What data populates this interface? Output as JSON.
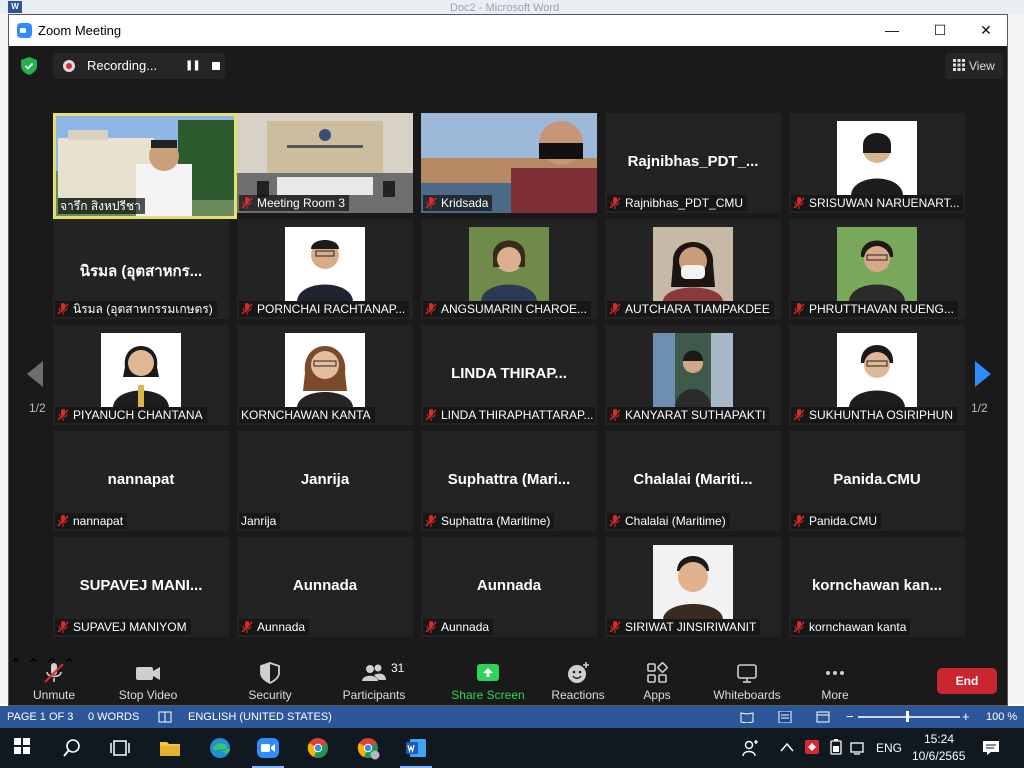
{
  "background_app": {
    "title": "Doc2 - Microsoft Word",
    "logo": "W"
  },
  "window": {
    "title": "Zoom Meeting",
    "minimize": "—",
    "maximize": "☐",
    "close": "✕"
  },
  "recording": {
    "label": "Recording...",
    "pause": "❚❚"
  },
  "view": {
    "label": "View"
  },
  "tiles": [
    {
      "label": "จารึก สิงหปรีชา",
      "muted": false,
      "active": true
    },
    {
      "label": "Meeting Room 3",
      "muted": true
    },
    {
      "label": "Kridsada",
      "muted": true
    },
    {
      "big_name": "Rajnibhas_PDT_...",
      "label": "Rajnibhas_PDT_CMU",
      "muted": true
    },
    {
      "label": "SRISUWAN NARUENART...",
      "muted": true
    },
    {
      "big_name": "นิรมล (อุตสาหกร...",
      "label": "นิรมล (อุตสาหกรรมเกษตร)",
      "muted": true
    },
    {
      "label": "PORNCHAI RACHTANAP...",
      "muted": true
    },
    {
      "label": "ANGSUMARIN CHAROE...",
      "muted": true
    },
    {
      "label": "AUTCHARA TIAMPAKDEE",
      "muted": true
    },
    {
      "label": "PHRUTTHAVAN RUENG...",
      "muted": true
    },
    {
      "label": "PIYANUCH CHANTANA",
      "muted": true
    },
    {
      "label": "KORNCHAWAN KANTA",
      "muted": false
    },
    {
      "big_name": "LINDA THIRAP...",
      "label": "LINDA THIRAPHATTARAP...",
      "muted": true
    },
    {
      "label": "KANYARAT SUTHAPAKTI",
      "muted": true
    },
    {
      "label": "SUKHUNTHA OSIRIPHUN",
      "muted": true
    },
    {
      "big_name": "nannapat",
      "label": "nannapat",
      "muted": true
    },
    {
      "big_name": "Janrija",
      "label": "Janrija",
      "muted": false
    },
    {
      "big_name": "Suphattra  (Mari...",
      "label": "Suphattra (Maritime)",
      "muted": true
    },
    {
      "big_name": "Chalalai  (Mariti...",
      "label": "Chalalai (Maritime)",
      "muted": true
    },
    {
      "big_name": "Panida.CMU",
      "label": "Panida.CMU",
      "muted": true
    },
    {
      "big_name": "SUPAVEJ  MANI...",
      "label": "SUPAVEJ MANIYOM",
      "muted": true
    },
    {
      "big_name": "Aunnada",
      "label": "Aunnada",
      "muted": true
    },
    {
      "big_name": "Aunnada",
      "label": "Aunnada",
      "muted": true
    },
    {
      "label": "SIRIWAT JINSIRIWANIT",
      "muted": true
    },
    {
      "big_name": "kornchawan  kan...",
      "label": "kornchawan kanta",
      "muted": true
    }
  ],
  "pagination": {
    "left": "1/2",
    "right": "1/2"
  },
  "toolbar": {
    "unmute": "Unmute",
    "stop_video": "Stop Video",
    "security": "Security",
    "participants": "Participants",
    "participants_count": "31",
    "share_screen": "Share Screen",
    "reactions": "Reactions",
    "apps": "Apps",
    "whiteboards": "Whiteboards",
    "more": "More",
    "end": "End"
  },
  "statusbar": {
    "page": "PAGE 1 OF 3",
    "words": "0 WORDS",
    "language": "ENGLISH (UNITED STATES)",
    "zoom": "100 %",
    "zoom_out": "−",
    "zoom_in": "+"
  },
  "taskbar": {
    "language": "ENG",
    "time": "15:24",
    "date": "10/6/2565"
  },
  "colors": {
    "accent_green": "#2fd35a",
    "end_red": "#c9262f",
    "active_border": "#e4e06b",
    "word_blue": "#2b579a"
  }
}
